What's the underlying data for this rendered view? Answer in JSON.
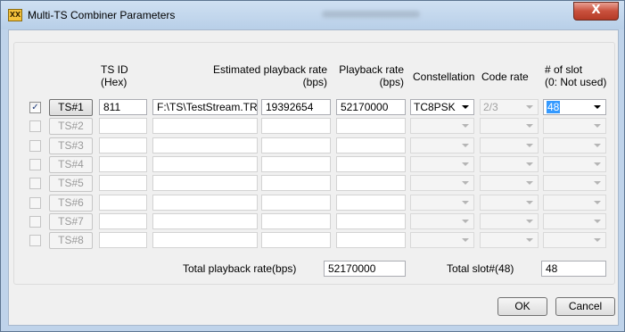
{
  "window": {
    "app_icon_text": "XX",
    "title": "Multi-TS Combiner Parameters",
    "close_glyph": "X"
  },
  "table": {
    "headers": {
      "ts_id": "TS ID\n(Hex)",
      "estimated_rate": "Estimated playback rate\n(bps)",
      "playback_rate": "Playback rate\n(bps)",
      "constellation": "Constellation",
      "code_rate": "Code rate",
      "slots": "# of slot\n(0: Not used)"
    },
    "rows": [
      {
        "checked": true,
        "enabled": true,
        "button": "TS#1",
        "ts_id": "811",
        "file": "F:\\TS\\TestStream.TRP",
        "est_rate": "19392654",
        "play_rate": "52170000",
        "constellation": "TC8PSK",
        "code_rate": "2/3",
        "slots": "48"
      },
      {
        "checked": false,
        "enabled": false,
        "button": "TS#2",
        "ts_id": "",
        "file": "",
        "est_rate": "",
        "play_rate": "",
        "constellation": "",
        "code_rate": "",
        "slots": ""
      },
      {
        "checked": false,
        "enabled": false,
        "button": "TS#3",
        "ts_id": "",
        "file": "",
        "est_rate": "",
        "play_rate": "",
        "constellation": "",
        "code_rate": "",
        "slots": ""
      },
      {
        "checked": false,
        "enabled": false,
        "button": "TS#4",
        "ts_id": "",
        "file": "",
        "est_rate": "",
        "play_rate": "",
        "constellation": "",
        "code_rate": "",
        "slots": ""
      },
      {
        "checked": false,
        "enabled": false,
        "button": "TS#5",
        "ts_id": "",
        "file": "",
        "est_rate": "",
        "play_rate": "",
        "constellation": "",
        "code_rate": "",
        "slots": ""
      },
      {
        "checked": false,
        "enabled": false,
        "button": "TS#6",
        "ts_id": "",
        "file": "",
        "est_rate": "",
        "play_rate": "",
        "constellation": "",
        "code_rate": "",
        "slots": ""
      },
      {
        "checked": false,
        "enabled": false,
        "button": "TS#7",
        "ts_id": "",
        "file": "",
        "est_rate": "",
        "play_rate": "",
        "constellation": "",
        "code_rate": "",
        "slots": ""
      },
      {
        "checked": false,
        "enabled": false,
        "button": "TS#8",
        "ts_id": "",
        "file": "",
        "est_rate": "",
        "play_rate": "",
        "constellation": "",
        "code_rate": "",
        "slots": ""
      }
    ]
  },
  "totals": {
    "playback_label": "Total playback rate(bps)",
    "playback_value": "52170000",
    "slot_label": "Total slot#(48)",
    "slot_value": "48"
  },
  "footer": {
    "ok_label": "OK",
    "cancel_label": "Cancel"
  },
  "colors": {
    "title_bar": "#c4d8ee",
    "close_button": "#c9503c",
    "selection": "#3399ff"
  }
}
